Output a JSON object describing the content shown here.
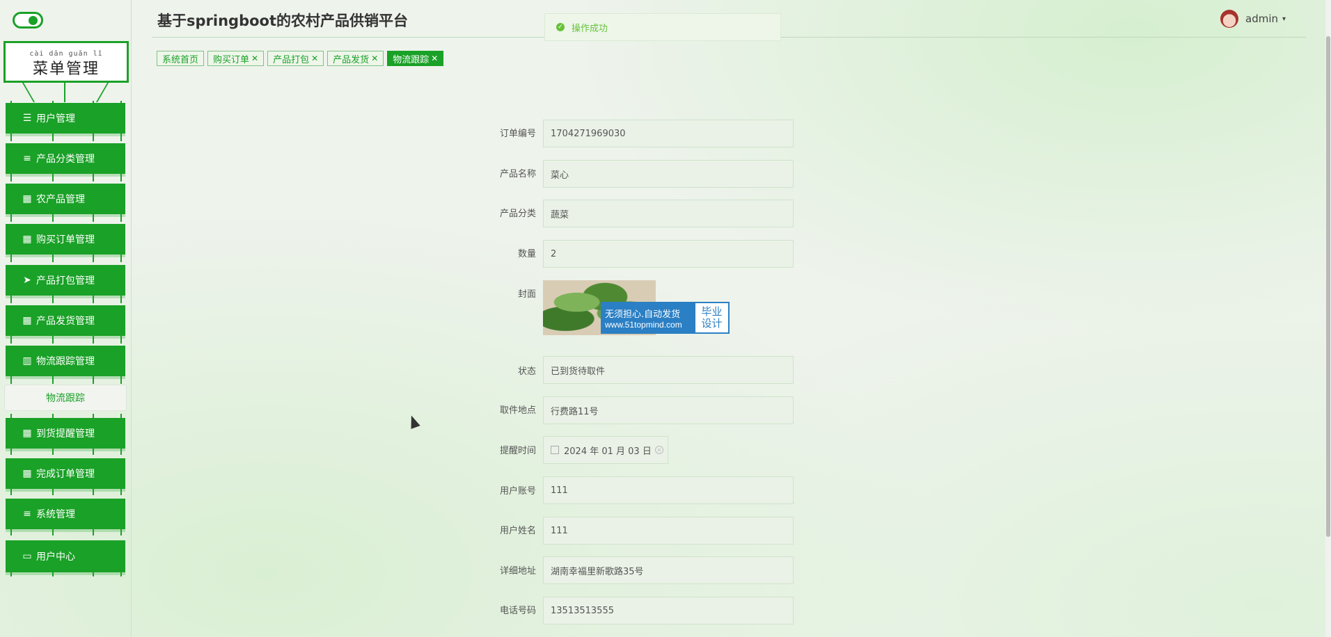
{
  "app": {
    "title": "基于springboot的农村产品供销平台",
    "user": "admin"
  },
  "toast": {
    "message": "操作成功"
  },
  "sidebar": {
    "menu_pinyin": "cài dān guǎn lǐ",
    "menu_title": "菜单管理",
    "items": [
      {
        "label": "用户管理",
        "icon": "sliders-icon"
      },
      {
        "label": "产品分类管理",
        "icon": "list-icon"
      },
      {
        "label": "农产品管理",
        "icon": "grid-icon"
      },
      {
        "label": "购买订单管理",
        "icon": "grid-icon"
      },
      {
        "label": "产品打包管理",
        "icon": "paper-plane-icon"
      },
      {
        "label": "产品发货管理",
        "icon": "grid-icon"
      },
      {
        "label": "物流跟踪管理",
        "icon": "bar-chart-icon"
      },
      {
        "label": "到货提醒管理",
        "icon": "grid-icon"
      },
      {
        "label": "完成订单管理",
        "icon": "grid-icon"
      },
      {
        "label": "系统管理",
        "icon": "list-icon"
      },
      {
        "label": "用户中心",
        "icon": "card-icon"
      }
    ],
    "sub_item": "物流跟踪"
  },
  "tabs": [
    {
      "label": "系统首页",
      "closable": false
    },
    {
      "label": "购买订单",
      "closable": true
    },
    {
      "label": "产品打包",
      "closable": true
    },
    {
      "label": "产品发货",
      "closable": true
    },
    {
      "label": "物流跟踪",
      "closable": true,
      "active": true
    }
  ],
  "form": {
    "order_no": {
      "label": "订单编号",
      "value": "1704271969030"
    },
    "product_name": {
      "label": "产品名称",
      "value": "菜心"
    },
    "category": {
      "label": "产品分类",
      "value": "蔬菜"
    },
    "quantity": {
      "label": "数量",
      "value": "2"
    },
    "cover": {
      "label": "封面",
      "watermark_line1": "无须担心.自动发货",
      "watermark_line2": "www.51topmind.com",
      "watermark_right1": "毕业",
      "watermark_right2": "设计"
    },
    "status": {
      "label": "状态",
      "value": "已到货待取件"
    },
    "pickup": {
      "label": "取件地点",
      "value": "行费路11号"
    },
    "remind_time": {
      "label": "提醒时间",
      "value": "2024 年 01 月 03 日"
    },
    "account": {
      "label": "用户账号",
      "value": "111"
    },
    "name": {
      "label": "用户姓名",
      "value": "111"
    },
    "address": {
      "label": "详细地址",
      "value": "湖南幸福里新歌路35号"
    },
    "phone": {
      "label": "电话号码",
      "value": "13513513555"
    }
  },
  "colors": {
    "accent": "#1aa127",
    "success": "#67c23a"
  }
}
